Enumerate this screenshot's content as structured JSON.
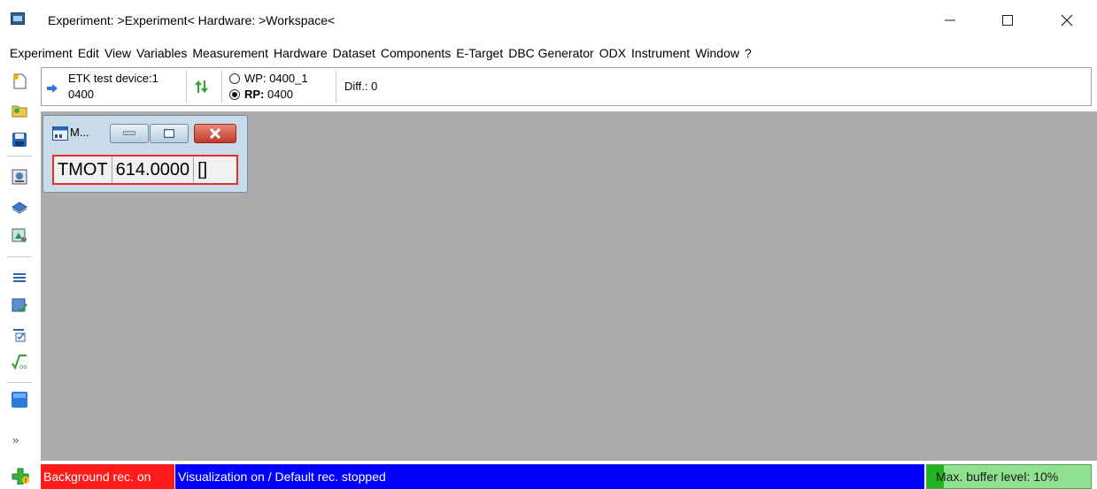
{
  "window": {
    "title": "Experiment: >Experiment< Hardware: >Workspace<",
    "icons": {
      "app": "app-window-icon",
      "minimize": "minimize-icon",
      "maximize": "maximize-icon",
      "close": "close-icon"
    }
  },
  "menu": {
    "items": [
      "Experiment",
      "Edit",
      "View",
      "Variables",
      "Measurement",
      "Hardware",
      "Dataset",
      "Components",
      "E-Target",
      "DBC Generator",
      "ODX",
      "Instrument",
      "Window",
      "?"
    ]
  },
  "toolbar": {
    "icons": [
      "new-experiment-icon",
      "open-experiment-icon",
      "save-icon",
      "hardware-config-icon",
      "dataset-icon",
      "calibration-icon",
      "variable-selection-icon",
      "measure-config-icon",
      "check-icon",
      "formula-icon",
      "window-icon"
    ],
    "more": "»"
  },
  "device": {
    "name": "ETK test device:1",
    "number": "0400",
    "wp_label": "WP:",
    "wp_value": "0400_1",
    "rp_label": "RP:",
    "rp_value": "0400",
    "selected_page": "RP",
    "diff": "Diff.: 0"
  },
  "measure_window": {
    "title": "M...",
    "variable": "TMOT",
    "value": "614.0000",
    "unit": "[]"
  },
  "status": {
    "background_rec": "Background rec. on",
    "visualization": "Visualization on / Default rec. stopped",
    "buffer": "Max. buffer level: 10%",
    "buffer_level": 0.1,
    "colors": {
      "background_rec": "#ff1a1a",
      "visualization": "#0000ff",
      "buffer": "#8fe08f"
    }
  }
}
